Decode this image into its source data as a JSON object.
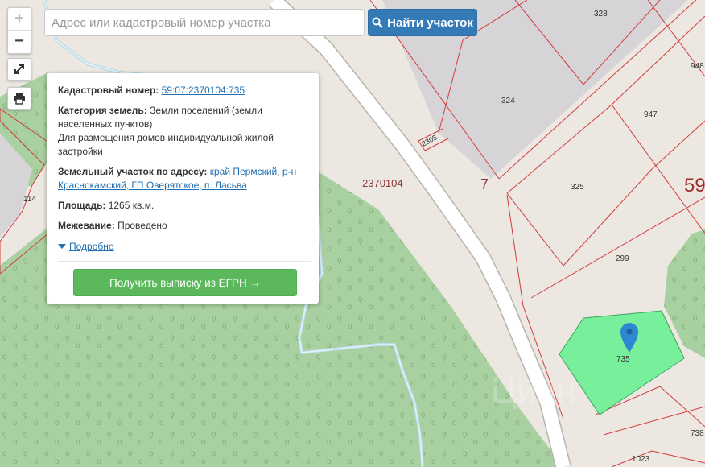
{
  "search": {
    "placeholder": "Адрес или кадастровый номер участка",
    "button_label": "Найти участок"
  },
  "zoom": {
    "in_label": "+",
    "out_label": "−"
  },
  "tools": {
    "fullscreen_icon": "expand-icon",
    "print_icon": "print-icon",
    "search_icon": "search-icon"
  },
  "popup": {
    "cadastral_label": "Кадастровый номер:",
    "cadastral_value": "59:07:2370104:735",
    "category_label": "Категория земель:",
    "category_value": "Земли поселений (земли населенных пунктов)",
    "purpose_value": "Для размещения домов индивидуальной жилой застройки",
    "address_label": "Земельный участок по адресу:",
    "address_value": "край Пермский, р-н Краснокамский, ГП Оверятское, п. Ласьва",
    "area_label": "Площадь:",
    "area_value": "1265 кв.м.",
    "survey_label": "Межевание:",
    "survey_value": "Проведено",
    "details_label": "Подробно",
    "egrn_button": "Получить выписку из ЕГРН →"
  },
  "map_labels": {
    "block": "2370104",
    "quarter": "7",
    "district": "59",
    "parcel_114": "114",
    "parcel_328": "328",
    "parcel_324": "324",
    "parcel_948": "948",
    "parcel_947": "947",
    "parcel_325": "325",
    "parcel_299": "299",
    "parcel_735": "735",
    "parcel_738": "738",
    "parcel_1023": "1023",
    "parcel_2305": "2305"
  },
  "colors": {
    "background": "#ece8e1",
    "forest": "#a9d0a0",
    "road": "#ffffff",
    "building": "#d7d4d8",
    "parcel_border": "#d23c3c",
    "highlight": "#78ef9b",
    "marker": "#2f86d1",
    "primary": "#337ab7",
    "success": "#5cb85c"
  }
}
